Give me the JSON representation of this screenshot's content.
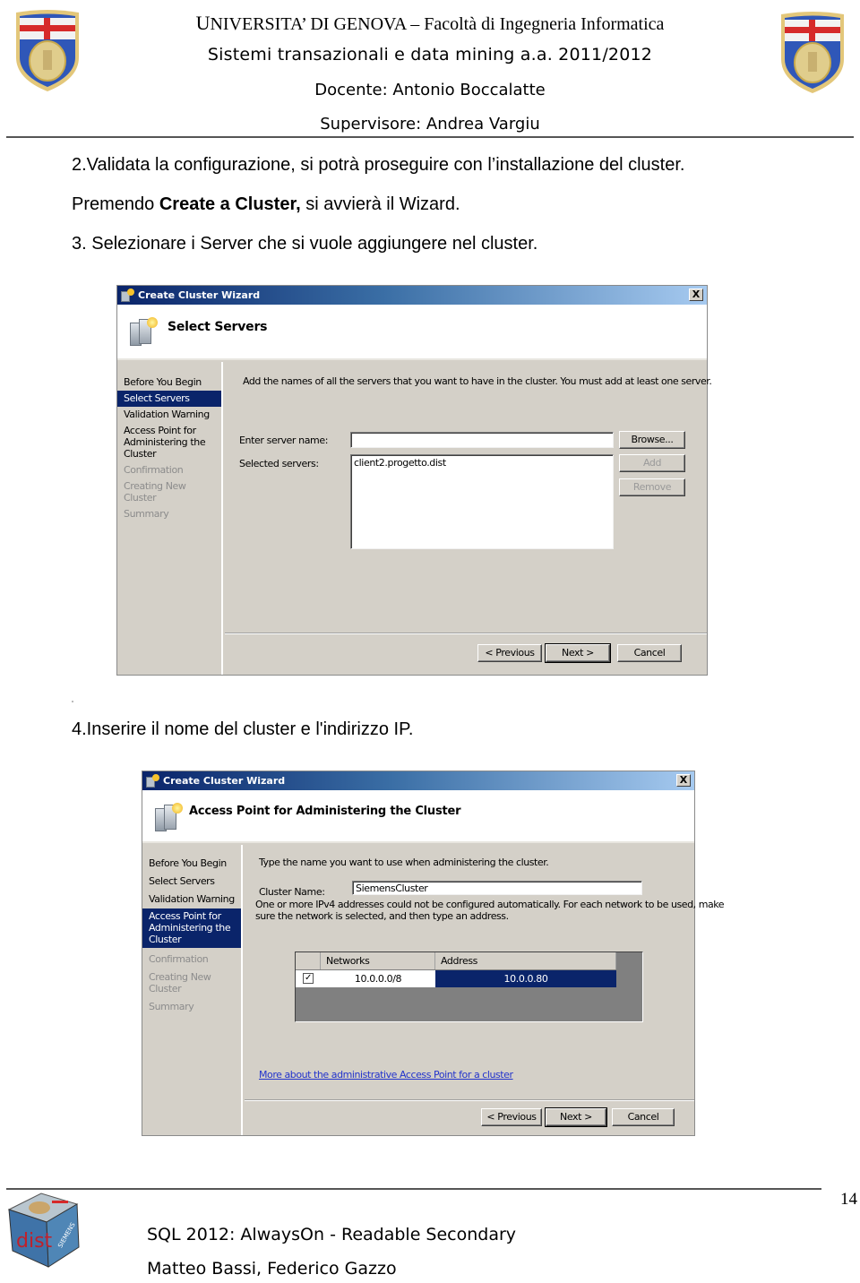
{
  "header": {
    "university_first_letter": "U",
    "university_rest": "NIVERSITA’ DI GENOVA – Facoltà di Ingegneria Informatica",
    "course": "Sistemi transazionali e data mining  a.a. 2011/2012",
    "docente": "Docente: Antonio Boccalatte",
    "supervisore": "Supervisore: Andrea Vargiu",
    "crest_icon": "university-genova-crest-icon"
  },
  "body": {
    "step2": "2.Validata la configurazione, si potrà proseguire con l’installazione del cluster.",
    "step2b_pre": "Premendo ",
    "step2b_bold": "Create a Cluster,",
    "step2b_post": " si avvierà il Wizard.",
    "step3": "3. Selezionare i Server che si vuole aggiungere nel cluster.",
    "step4": "4.Inserire il nome del cluster e l'indirizzo IP."
  },
  "wizard1": {
    "window_title": "Create Cluster Wizard",
    "close_glyph": "X",
    "page_title": "Select Servers",
    "steps": [
      {
        "label": "Before You Begin",
        "state": "normal"
      },
      {
        "label": "Select Servers",
        "state": "active"
      },
      {
        "label": "Validation Warning",
        "state": "normal"
      },
      {
        "label": "Access Point for Administering the Cluster",
        "state": "normal"
      },
      {
        "label": "Confirmation",
        "state": "disabled"
      },
      {
        "label": "Creating New Cluster",
        "state": "disabled"
      },
      {
        "label": "Summary",
        "state": "disabled"
      }
    ],
    "instructions": "Add the names of all the servers that you want to have in the cluster. You must add at least one server.",
    "server_name_label": "Enter server name:",
    "server_name_value": "",
    "selected_servers_label": "Selected servers:",
    "selected_servers": [
      "client2.progetto.dist"
    ],
    "browse_label": "Browse...",
    "add_label": "Add",
    "remove_label": "Remove",
    "previous_label": "< Previous",
    "next_label": "Next >",
    "cancel_label": "Cancel"
  },
  "wizard2": {
    "window_title": "Create Cluster Wizard",
    "close_glyph": "X",
    "page_title": "Access Point for Administering the Cluster",
    "steps": [
      {
        "label": "Before You Begin",
        "state": "normal"
      },
      {
        "label": "Select Servers",
        "state": "normal"
      },
      {
        "label": "Validation Warning",
        "state": "normal"
      },
      {
        "label": "Access Point for Administering the Cluster",
        "state": "active"
      },
      {
        "label": "Confirmation",
        "state": "disabled"
      },
      {
        "label": "Creating New Cluster",
        "state": "disabled"
      },
      {
        "label": "Summary",
        "state": "disabled"
      }
    ],
    "instructions": "Type the name you want to use when administering the cluster.",
    "cluster_name_label": "Cluster Name:",
    "cluster_name_value": "SiemensCluster",
    "ipv4_note_line1": "One or more IPv4 addresses could not be configured automatically.  For each network to be used, make",
    "ipv4_note_line2": "sure the network is selected, and then type an address.",
    "table": {
      "columns": [
        "",
        "Networks",
        "Address"
      ],
      "rows": [
        {
          "checked": true,
          "check_glyph": "✓",
          "network": "10.0.0.0/8",
          "address": "10.0.0.80"
        }
      ]
    },
    "help_link": "More about the administrative Access Point for a cluster",
    "previous_label": "< Previous",
    "next_label": "Next >",
    "cancel_label": "Cancel"
  },
  "footer": {
    "page_number": "14",
    "title": "SQL  2012: AlwaysOn - Readable Secondary",
    "authors": "Matteo Bassi, Federico Gazzo",
    "logo_icon": "dist-siemens-cube-logo-icon"
  }
}
